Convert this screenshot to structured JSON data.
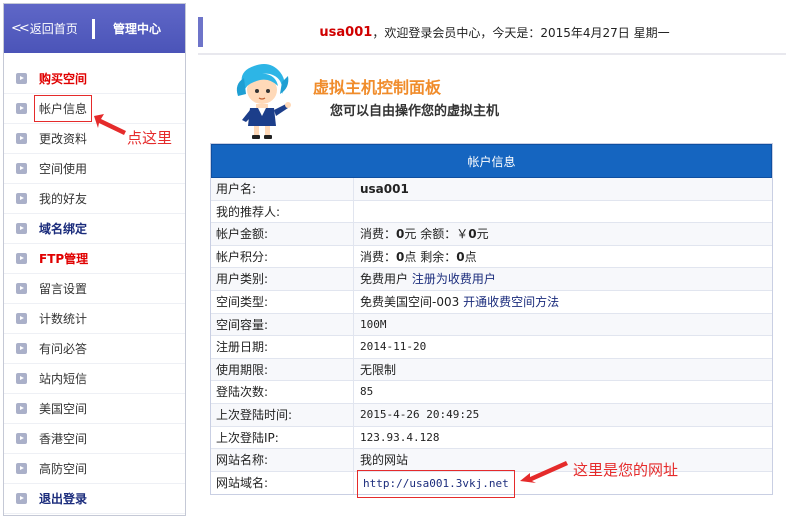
{
  "sidebar": {
    "back_home": "返回首页",
    "title": "管理中心",
    "items": [
      {
        "label": "购买空间",
        "style": "red"
      },
      {
        "label": "帐户信息",
        "style": "boxed"
      },
      {
        "label": "更改资料",
        "style": "normal"
      },
      {
        "label": "空间使用",
        "style": "normal"
      },
      {
        "label": "我的好友",
        "style": "normal"
      },
      {
        "label": "域名绑定",
        "style": "navy"
      },
      {
        "label": "FTP管理",
        "style": "red"
      },
      {
        "label": "留言设置",
        "style": "normal"
      },
      {
        "label": "计数统计",
        "style": "normal"
      },
      {
        "label": "有问必答",
        "style": "normal"
      },
      {
        "label": "站内短信",
        "style": "normal"
      },
      {
        "label": "美国空间",
        "style": "normal"
      },
      {
        "label": "香港空间",
        "style": "normal"
      },
      {
        "label": "高防空间",
        "style": "normal"
      },
      {
        "label": "退出登录",
        "style": "navy"
      }
    ]
  },
  "header": {
    "username": "usa001",
    "greeting": "，欢迎登录会员中心，今天是：2015年4月27日 星期一"
  },
  "panel": {
    "title": "虚拟主机控制面板",
    "subtitle": "您可以自由操作您的虚拟主机"
  },
  "table": {
    "title": "帐户信息",
    "rows": {
      "username": {
        "label": "用户名:",
        "value": "usa001"
      },
      "referrer": {
        "label": "我的推荐人:",
        "value": ""
      },
      "balance": {
        "label": "帐户金额:",
        "spent_prefix": "消费：",
        "spent": "0",
        "spent_unit": "元  余额：￥",
        "remain": "0",
        "remain_unit": "元"
      },
      "points": {
        "label": "帐户积分:",
        "spent_prefix": "消费：",
        "spent": "0",
        "spent_unit": "点  剩余：",
        "remain": "0",
        "remain_unit": "点"
      },
      "user_type": {
        "label": "用户类别:",
        "value": "免费用户",
        "link": "注册为收费用户"
      },
      "space_type": {
        "label": "空间类型:",
        "value": "免费美国空间-003",
        "link": "开通收费空间方法"
      },
      "capacity": {
        "label": "空间容量:",
        "value": "100M"
      },
      "reg_date": {
        "label": "注册日期:",
        "value": "2014-11-20"
      },
      "term": {
        "label": "使用期限:",
        "value": "无限制"
      },
      "logins": {
        "label": "登陆次数:",
        "value": "85"
      },
      "last_time": {
        "label": "上次登陆时间:",
        "value": "2015-4-26 20:49:25"
      },
      "last_ip": {
        "label": "上次登陆IP:",
        "value": "123.93.4.128"
      },
      "site_name": {
        "label": "网站名称:",
        "value": "我的网站"
      },
      "domain": {
        "label": "网站域名:",
        "value": "http://usa001.3vkj.net"
      }
    }
  },
  "annotations": {
    "click_here": "点这里",
    "your_url": "这里是您的网址"
  },
  "colors": {
    "sidebar_head": "#5059bb",
    "table_head": "#1565c0",
    "annotation_red": "#e52b2b",
    "panel_title": "#f08c2b"
  },
  "icons": {
    "menu_bullet": "play-bullet-icon",
    "back": "double-chevron-left-icon",
    "mascot": "cartoon-girl-mascot"
  }
}
